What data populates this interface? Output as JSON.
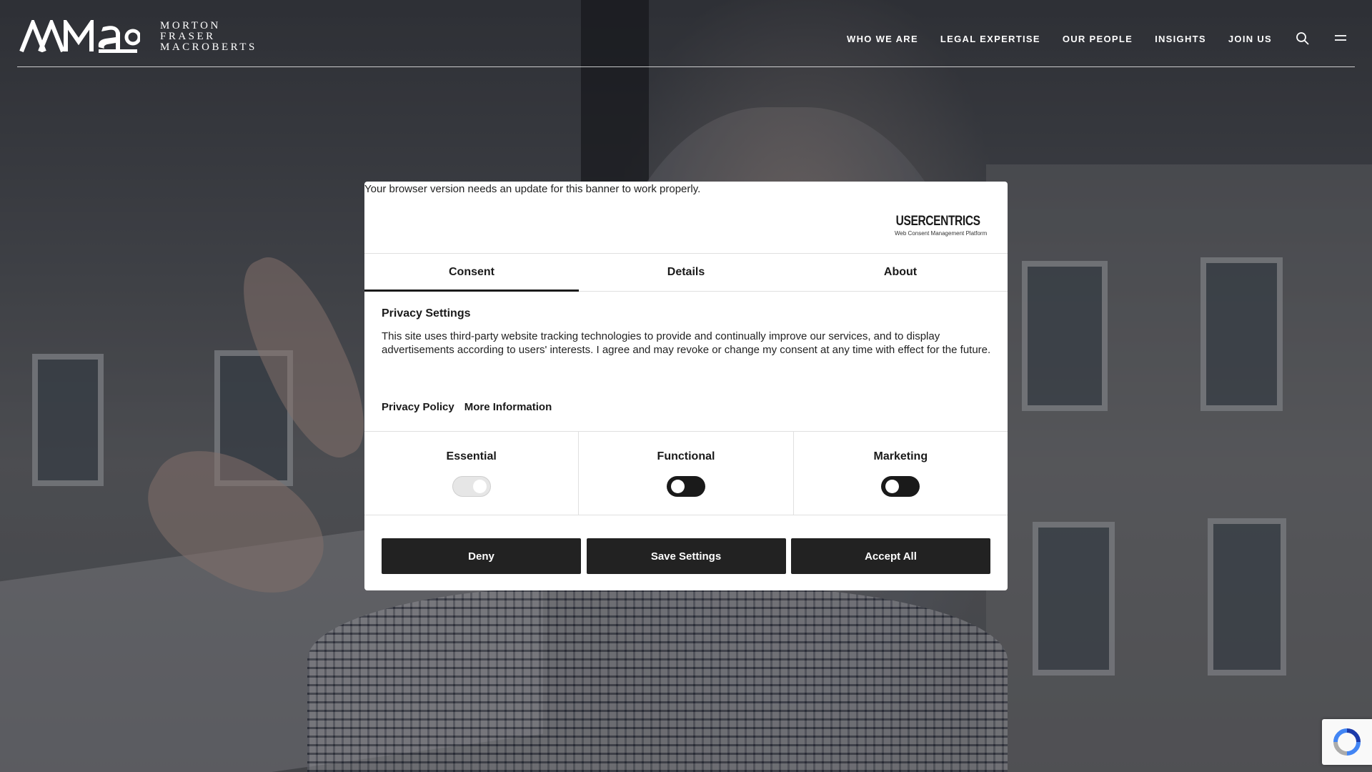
{
  "header": {
    "logo_text_lines": [
      "MORTON",
      "FRASER",
      "MACROBERTS"
    ],
    "nav": [
      "WHO WE ARE",
      "LEGAL EXPERTISE",
      "OUR PEOPLE",
      "INSIGHTS",
      "JOIN US"
    ],
    "icons": [
      "search-icon",
      "menu-icon"
    ]
  },
  "consent": {
    "notice": "Your browser version needs an update for this banner to work properly.",
    "brand": {
      "title": "USERCENTRICS",
      "subtitle": "Web Consent Management Platform"
    },
    "tabs": [
      "Consent",
      "Details",
      "About"
    ],
    "active_tab": "Consent",
    "heading": "Privacy Settings",
    "body": "This site uses third-party website tracking technologies to provide and continually improve our services, and to display advertisements according to users' interests. I agree and may revoke or change my consent at any time with effect for the future.",
    "links": [
      "Privacy Policy",
      "More Information"
    ],
    "categories": [
      {
        "label": "Essential",
        "enabled": true,
        "locked": true
      },
      {
        "label": "Functional",
        "enabled": false
      },
      {
        "label": "Marketing",
        "enabled": false
      }
    ],
    "buttons": {
      "deny": "Deny",
      "save": "Save Settings",
      "accept": "Accept All"
    }
  },
  "colors": {
    "button_bg": "#222222",
    "toggle_off": "#1a1a1a",
    "toggle_on_locked": "#e6e6e6",
    "header_text": "#ffffff"
  }
}
